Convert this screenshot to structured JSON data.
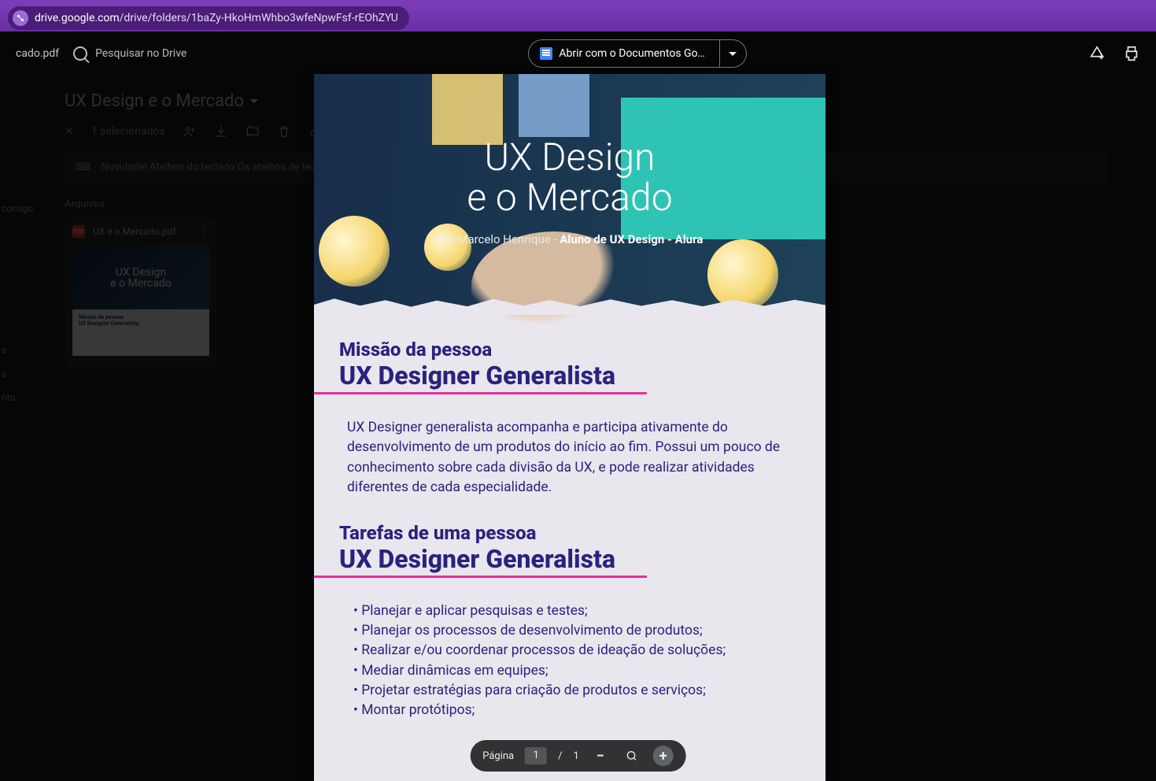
{
  "url": {
    "host": "drive.google.com",
    "path": "/drive/folders/1baZy-HkoHmWhbo3wfeNpwFsf-rEOhZYU"
  },
  "viewer": {
    "filename_trunc": "cado.pdf",
    "search_placeholder": "Pesquisar no Drive",
    "open_label": "Abrir com o Documentos Go…"
  },
  "drive": {
    "title": "UX Design e o Mercado",
    "selected": "1 selecionados",
    "notice": "Novidade! Atalhos do teclado Os atalhos de teclad",
    "section": "Arquivos",
    "sidebar_items": [
      "comigo",
      "s",
      "a",
      "nto"
    ],
    "file": {
      "name": "UX e o Mercado.pdf",
      "thumb_title1": "UX Design",
      "thumb_title2": "e o Mercado",
      "thumb_sub1": "Missão da pessoa",
      "thumb_sub2": "UX Designer Generalista"
    }
  },
  "doc": {
    "title_l1": "UX Design",
    "title_l2": "e o Mercado",
    "byline_pre": "Por Marcelo Henrique - ",
    "byline_bold": "Aluno de UX Design - Alura",
    "h1_sup": "Missão da pessoa",
    "h1_main": "UX Designer Generalista",
    "para": "UX Designer generalista acompanha e participa ativamente do desenvolvimento de um produtos do início ao fim. Possui um pouco de conhecimento sobre cada divisão da UX, e pode realizar atividades diferentes de cada especialidade.",
    "h2_sup": "Tarefas de uma pessoa",
    "h2_main": "UX Designer Generalista",
    "tasks": [
      "Planejar e aplicar pesquisas e testes;",
      "Planejar os processos de desenvolvimento de produtos;",
      "Realizar e/ou coordenar processos de ideação de soluções;",
      "Mediar dinâmicas em equipes;",
      "Projetar estratégias para criação de produtos e serviços;",
      "Montar protótipos;"
    ]
  },
  "page_ctrl": {
    "label": "Página",
    "current": "1",
    "sep": "/",
    "total": "1"
  }
}
